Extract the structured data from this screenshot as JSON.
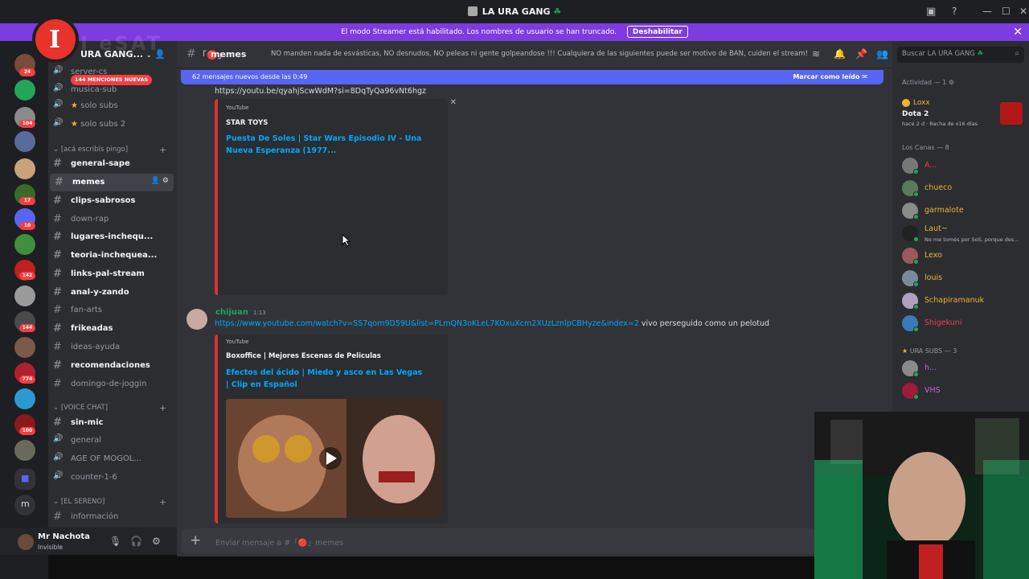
{
  "window": {
    "title": "LA URA GANG",
    "controls": [
      "—",
      "☐",
      "✕"
    ]
  },
  "streamer_banner": {
    "text": "El modo Streamer está habilitado. Los nombres de usuario se han truncado.",
    "button": "Deshabilitar"
  },
  "watermark": "I   eSAT",
  "guild_badges": [
    "24",
    "104",
    "17",
    "10",
    "142",
    "144",
    "774",
    "100"
  ],
  "server": {
    "name": "URA GANG...",
    "mentions_pill": "144 MENCIONES NUEVAS"
  },
  "channels": {
    "voice_top": [
      "server-cs",
      "musica-sub",
      "solo subs",
      "solo subs 2"
    ],
    "category1": "[acá escribís pingo]",
    "text": [
      {
        "name": "general-sape",
        "emoji": "💬",
        "bright": true
      },
      {
        "name": "memes",
        "emoji": "🔴",
        "bright": true,
        "selected": true
      },
      {
        "name": "clips-sabrosos",
        "emoji": "🎬",
        "bright": true
      },
      {
        "name": "down-rap",
        "emoji": "🎤",
        "bright": false
      },
      {
        "name": "lugares-inchequ...",
        "emoji": "🍄",
        "bright": true
      },
      {
        "name": "teoria-inchequea...",
        "emoji": "❓",
        "bright": true
      },
      {
        "name": "links-pal-stream",
        "emoji": "⚡",
        "bright": true
      },
      {
        "name": "anal-y-zando",
        "emoji": "🎵",
        "bright": true
      },
      {
        "name": "fan-arts",
        "emoji": "😜",
        "bright": false
      },
      {
        "name": "frikeadas",
        "emoji": "🎮",
        "bright": true
      },
      {
        "name": "ideas-ayuda",
        "emoji": "💡",
        "bright": false
      },
      {
        "name": "recomendaciones",
        "emoji": "🧠",
        "bright": true
      },
      {
        "name": "domingo-de-joggin",
        "emoji": "👖",
        "bright": false
      }
    ],
    "category2": "[VOICE CHAT]",
    "voice": [
      {
        "name": "sin-mic",
        "type": "text",
        "emoji": "🔴",
        "bright": true
      },
      {
        "name": "general",
        "type": "voice",
        "emoji": "🔊",
        "bright": false
      },
      {
        "name": "AGE OF MOGOL...",
        "type": "voice",
        "emoji": "🔊",
        "bright": false
      },
      {
        "name": "counter-1-6",
        "type": "voice",
        "emoji": "🎮",
        "bright": false
      }
    ],
    "category3": "[EL SERENO]",
    "info": [
      {
        "name": "información",
        "emoji": "",
        "bright": false
      }
    ]
  },
  "user": {
    "name": "Mr Nachota",
    "status": "Invisible"
  },
  "header": {
    "channel": "memes",
    "topic": "NO manden nada de esvásticas, NO desnudos, NO peleas ni gente golpeandose !!! Cualquiera de las siguientes puede ser motivo de BAN, cuiden el stream!"
  },
  "new_messages": {
    "text": "62 mensajes nuevos desde las 0:49",
    "mark": "Marcar como leído"
  },
  "messages": [
    {
      "link": "https://youtu.be/qyahjScwWdM?si=8DqTyQa96vNt6hgz",
      "embed": {
        "provider": "YouTube",
        "author": "STAR TOYS",
        "title": "Puesta De Soles | Star Wars Episodio IV - Una Nueva Esperanza (1977..."
      }
    },
    {
      "user": "chijuan",
      "time": "1:13",
      "link": "https://www.youtube.com/watch?v=SS7qom9D59U&list=PLmQN3oKLeL7KOxuXcm2XUzLznlpCBHyze&index=2",
      "text": " vivo perseguido como un pelotud",
      "embed": {
        "provider": "YouTube",
        "author": "Boxoffice | Mejores Escenas de Peliculas",
        "title": "Efectos del ácido | Miedo y asco en Las Vegas | Clip en Español"
      }
    }
  ],
  "composer": {
    "placeholder": "Enviar mensaje a #「🔴」memes"
  },
  "members": {
    "search": "Buscar LA URA GANG",
    "activity_header": "Actividad — 1",
    "activity": {
      "user": "Loxx",
      "game": "Dota 2",
      "time": "hace 2 d",
      "streak": "Racha de x16 días"
    },
    "group1": "Los Canas — 8",
    "list1": [
      {
        "name": "A...",
        "color": "#f23f43",
        "status": ""
      },
      {
        "name": "chueco",
        "color": "#f0b232",
        "status": ""
      },
      {
        "name": "garmalote",
        "color": "#f0b232",
        "status": ""
      },
      {
        "name": "Laut~",
        "color": "#f0b232",
        "status": "No me tomés por SoS, porque des..."
      },
      {
        "name": "Lexo",
        "color": "#f0b232",
        "status": ""
      },
      {
        "name": "louis",
        "color": "#f0b232",
        "status": ""
      },
      {
        "name": "Schapiramanuk",
        "color": "#f0b232",
        "status": ""
      },
      {
        "name": "Shigekuni",
        "color": "#f23f43",
        "status": ""
      }
    ],
    "group2": "URA SUBS — 3",
    "list2": [
      {
        "name": "h...",
        "color": "#c06bd6",
        "status": ""
      },
      {
        "name": "VHS",
        "color": "#c06bd6",
        "status": ""
      }
    ]
  }
}
